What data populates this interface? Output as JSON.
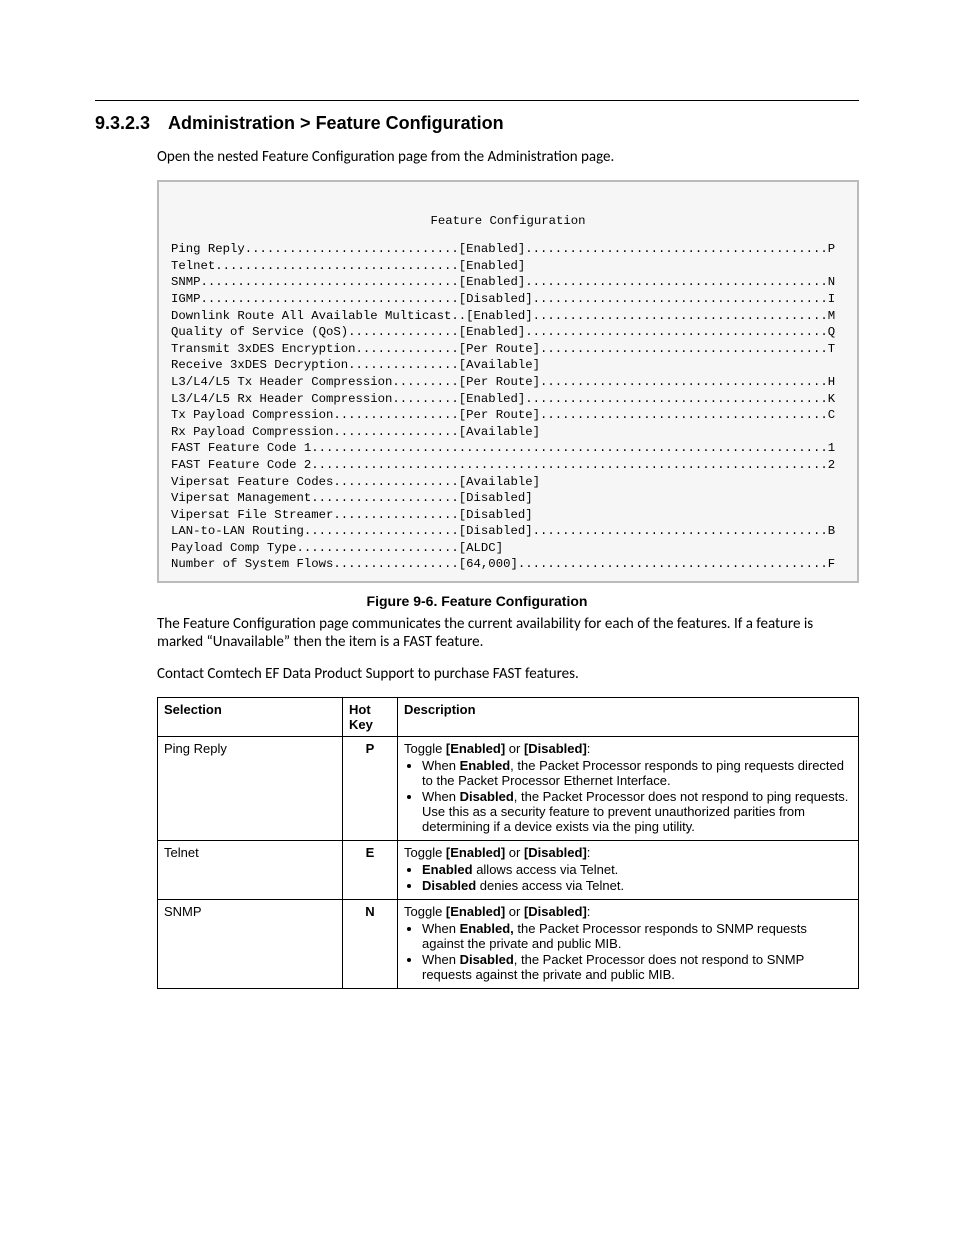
{
  "section_number": "9.3.2.3",
  "section_title": "Administration > Feature Configuration",
  "intro": "Open the nested Feature Configuration page from the Administration page.",
  "terminal": {
    "title": "Feature Configuration",
    "rows": [
      {
        "label": "Ping Reply",
        "status": "[Enabled]",
        "key": "P"
      },
      {
        "label": "Telnet",
        "status": "[Enabled]",
        "key": ""
      },
      {
        "label": "SNMP",
        "status": "[Enabled]",
        "key": "N"
      },
      {
        "label": "IGMP",
        "status": "[Disabled]",
        "key": "I"
      },
      {
        "label": "Downlink Route All Available Multicast",
        "status": "[Enabled]",
        "key": "M"
      },
      {
        "label": "Quality of Service (QoS)",
        "status": "[Enabled]",
        "key": "Q"
      },
      {
        "label": "Transmit 3xDES Encryption",
        "status": "[Per Route]",
        "key": "T"
      },
      {
        "label": "Receive 3xDES Decryption",
        "status": "[Available]",
        "key": ""
      },
      {
        "label": "L3/L4/L5 Tx Header Compression",
        "status": "[Per Route]",
        "key": "H"
      },
      {
        "label": "L3/L4/L5 Rx Header Compression",
        "status": "[Enabled]",
        "key": "K"
      },
      {
        "label": "Tx Payload Compression",
        "status": "[Per Route]",
        "key": "C"
      },
      {
        "label": "Rx Payload Compression",
        "status": "[Available]",
        "key": ""
      },
      {
        "label": "FAST Feature Code 1",
        "status": "",
        "key": "1"
      },
      {
        "label": "FAST Feature Code 2",
        "status": "",
        "key": "2"
      },
      {
        "label": "Vipersat Feature Codes",
        "status": "[Available]",
        "key": ""
      },
      {
        "label": "Vipersat Management",
        "status": "[Disabled]",
        "key": ""
      },
      {
        "label": "Vipersat File Streamer",
        "status": "[Disabled]",
        "key": ""
      },
      {
        "label": "LAN-to-LAN Routing",
        "status": "[Disabled]",
        "key": "B"
      },
      {
        "label": "Payload Comp Type",
        "status": "[ALDC]",
        "key": ""
      },
      {
        "label": "Number of System Flows",
        "status": "[64,000]",
        "key": "F"
      }
    ],
    "label_col_width": 39,
    "line_width": 90
  },
  "figure_caption": "Figure 9-6. Feature Configuration",
  "para1": "The Feature Configuration page communicates the current availability for each of the features. If a feature is marked “Unavailable” then the item is a FAST feature.",
  "para2": "Contact Comtech EF Data Product Support to purchase FAST features.",
  "table": {
    "headers": [
      "Selection",
      "Hot Key",
      "Description"
    ],
    "rows": [
      {
        "selection": "Ping Reply",
        "hotkey": "P",
        "lead": "Toggle [Enabled] or [Disabled]:",
        "bullets": [
          "When <b>Enabled</b>, the Packet Processor responds to ping requests directed to the Packet Processor Ethernet Interface.",
          "When <b>Disabled</b>, the Packet Processor does not respond to ping requests. Use this as a security feature to prevent unauthorized parities from determining if a device exists via the ping utility."
        ]
      },
      {
        "selection": "Telnet",
        "hotkey": "E",
        "lead": "Toggle [Enabled] or [Disabled]:",
        "bullets": [
          "<b>Enabled</b> allows access via Telnet.",
          "<b>Disabled</b> denies access via Telnet."
        ]
      },
      {
        "selection": "SNMP",
        "hotkey": "N",
        "lead": "Toggle [Enabled] or [Disabled]:",
        "bullets": [
          "When <b>Enabled,</b> the Packet Processor responds to SNMP requests against the private and public MIB.",
          "When <b>Disabled</b>, the Packet Processor does not respond to SNMP requests against the private and public MIB."
        ]
      }
    ]
  }
}
